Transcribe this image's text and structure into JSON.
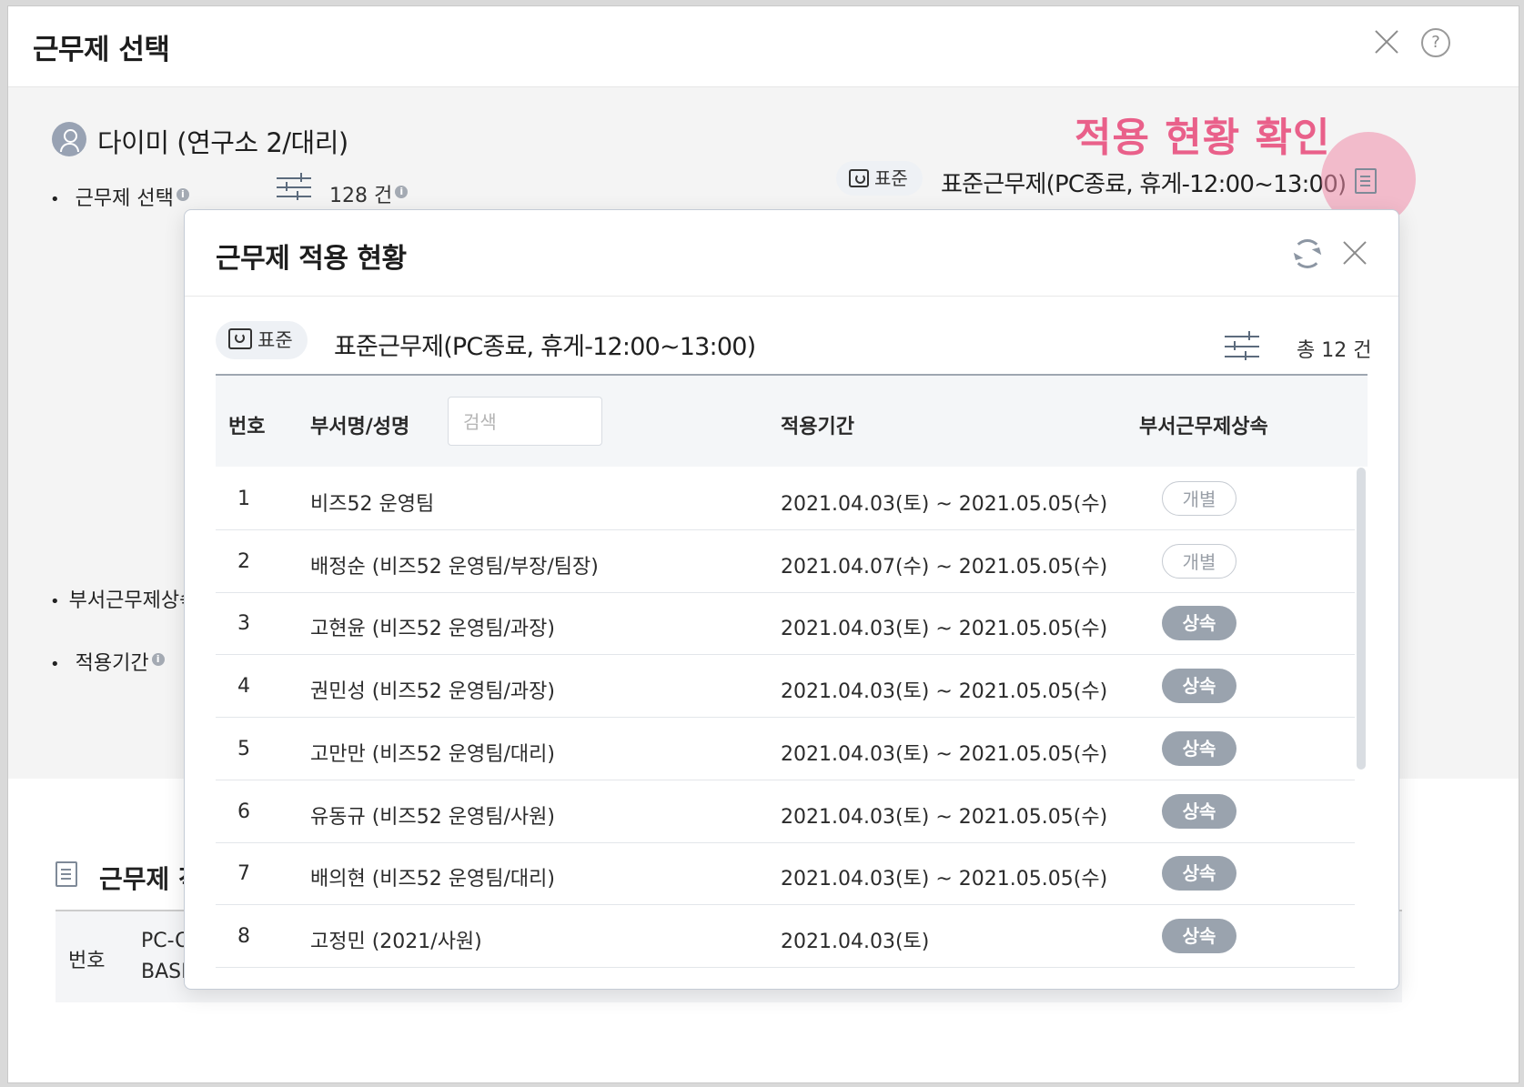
{
  "outer": {
    "title": "근무제 선택",
    "user_name": "다이미 (연구소 2/대리)",
    "label_select": "근무제 선택",
    "label_inherit": "부서근무제상속",
    "label_period": "적용기간",
    "count": "128 건",
    "badge": "표준",
    "policy": "표준근무제(PC종료, 휴게-12:00~13:00)",
    "annotation": "적용 현황 확인",
    "section_title": "근무제 적",
    "table_col_no": "번호",
    "table_col_pc": "PC-O",
    "table_col_basic": "BASIC"
  },
  "popup": {
    "title": "근무제 적용 현황",
    "badge": "표준",
    "policy": "표준근무제(PC종료, 휴게-12:00~13:00)",
    "total": "총 12 건",
    "columns": {
      "no": "번호",
      "name": "부서명/성명",
      "search_placeholder": "검색",
      "period": "적용기간",
      "inherit": "부서근무제상속"
    },
    "rows": [
      {
        "no": "1",
        "name": "비즈52 운영팀",
        "period": "2021.04.03(토) ~ 2021.05.05(수)",
        "status": "개별"
      },
      {
        "no": "2",
        "name": "배정순 (비즈52 운영팀/부장/팀장)",
        "period": "2021.04.07(수) ~ 2021.05.05(수)",
        "status": "개별"
      },
      {
        "no": "3",
        "name": "고현윤 (비즈52 운영팀/과장)",
        "period": "2021.04.03(토) ~ 2021.05.05(수)",
        "status": "상속"
      },
      {
        "no": "4",
        "name": "권민성 (비즈52 운영팀/과장)",
        "period": "2021.04.03(토) ~ 2021.05.05(수)",
        "status": "상속"
      },
      {
        "no": "5",
        "name": "고만만 (비즈52 운영팀/대리)",
        "period": "2021.04.03(토) ~ 2021.05.05(수)",
        "status": "상속"
      },
      {
        "no": "6",
        "name": "유동규 (비즈52 운영팀/사원)",
        "period": "2021.04.03(토) ~ 2021.05.05(수)",
        "status": "상속"
      },
      {
        "no": "7",
        "name": "배의현 (비즈52 운영팀/대리)",
        "period": "2021.04.03(토) ~ 2021.05.05(수)",
        "status": "상속"
      },
      {
        "no": "8",
        "name": "고정민 (2021/사원)",
        "period": "2021.04.03(토)",
        "status": "상속"
      }
    ]
  }
}
